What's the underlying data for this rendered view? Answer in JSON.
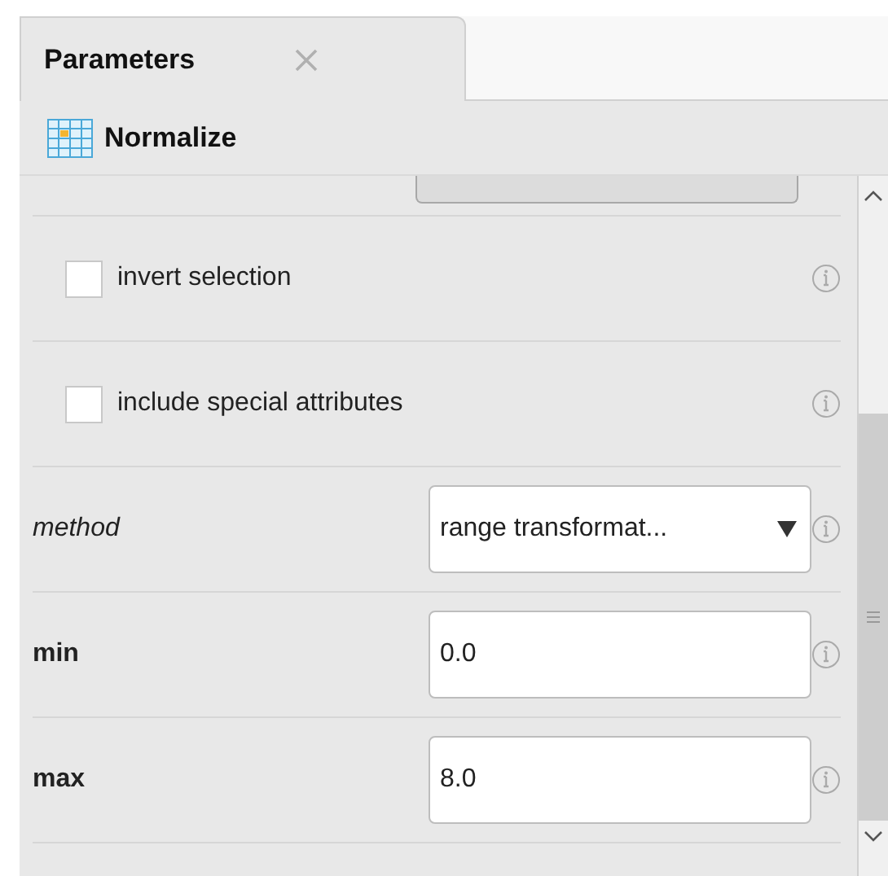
{
  "tabs": [
    {
      "label": "Parameters",
      "selected": true
    }
  ],
  "operator": {
    "name": "Normalize"
  },
  "parameters": [
    {
      "kind": "checkbox",
      "label": "invert selection",
      "checked": false,
      "italic": false,
      "bold": false
    },
    {
      "kind": "checkbox",
      "label": "include special attributes",
      "checked": false,
      "italic": false,
      "bold": false
    },
    {
      "kind": "select",
      "label": "method",
      "italic": true,
      "bold": false,
      "value": "range transformat..."
    },
    {
      "kind": "number",
      "label": "min",
      "italic": false,
      "bold": true,
      "value": "0.0"
    },
    {
      "kind": "number",
      "label": "max",
      "italic": false,
      "bold": true,
      "value": "8.0"
    }
  ]
}
